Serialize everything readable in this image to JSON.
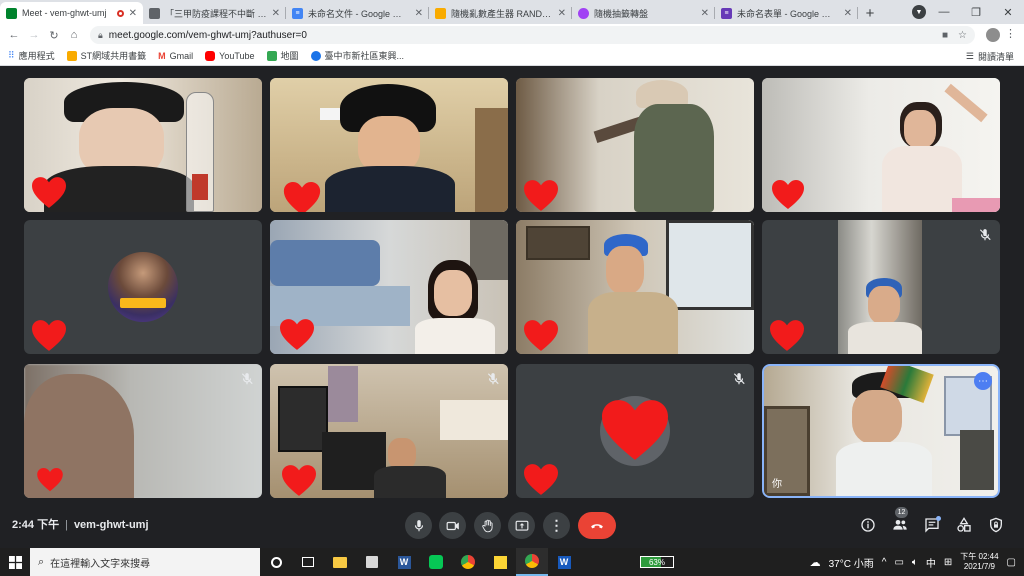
{
  "browser": {
    "tabs": [
      {
        "title": "Meet - vem-ghwt-umj",
        "fav_color": "#00832d",
        "active": true,
        "recording": true
      },
      {
        "title": "「三甲防疫課程不中斷 9」",
        "fav_color": "#5f6368",
        "active": false,
        "recording": false
      },
      {
        "title": "未命名文件 - Google 文件",
        "fav_color": "#4285f4",
        "active": false,
        "recording": false
      },
      {
        "title": "隨機亂數產生器 RANDOM",
        "fav_color": "#f9ab00",
        "active": false,
        "recording": false
      },
      {
        "title": "隨機抽籤轉盤",
        "fav_color": "#a142f4",
        "active": false,
        "recording": false
      },
      {
        "title": "未命名表單 - Google 表單",
        "fav_color": "#673ab7",
        "active": false,
        "recording": false
      }
    ],
    "url": "meet.google.com/vem-ghwt-umj?authuser=0",
    "bookmarks": [
      {
        "label": "應用程式",
        "color": "#4285f4"
      },
      {
        "label": "ST網域共用書籤",
        "color": "#f9ab00"
      },
      {
        "label": "Gmail",
        "color": "#ea4335"
      },
      {
        "label": "YouTube",
        "color": "#ff0000"
      },
      {
        "label": "地圖",
        "color": "#34a853"
      },
      {
        "label": "臺中市新社區東興...",
        "color": "#1a73e8"
      }
    ],
    "reading_list": "閱讀清單"
  },
  "meet": {
    "time": "2:44 下午",
    "meeting_code": "vem-ghwt-umj",
    "participant_count": "12",
    "self_label": "你",
    "heart_color": "#f21b1b",
    "accent": "#8ab4f8"
  },
  "taskbar": {
    "search_placeholder": "在這裡輸入文字來搜尋",
    "battery": "63%",
    "weather": "37°C 小雨",
    "ime": "中",
    "time": "下午 02:44",
    "date": "2021/7/9"
  }
}
